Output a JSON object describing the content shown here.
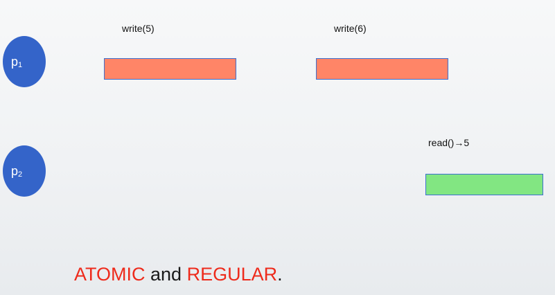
{
  "processes": [
    {
      "letter": "p",
      "index": "1"
    },
    {
      "letter": "p",
      "index": "2"
    }
  ],
  "operations": {
    "write1": {
      "label": "write(5)"
    },
    "write2": {
      "label": "write(6)"
    },
    "read1": {
      "label": "read()→5"
    }
  },
  "caption": {
    "word1": "ATOMIC",
    "connector": " and ",
    "word2": "REGULAR",
    "end": "."
  },
  "colors": {
    "process_fill": "#3464c9",
    "write_fill": "#ff8567",
    "read_fill": "#82e682",
    "bar_border": "#3b6fd0",
    "caption_highlight": "#ee2a1b"
  }
}
